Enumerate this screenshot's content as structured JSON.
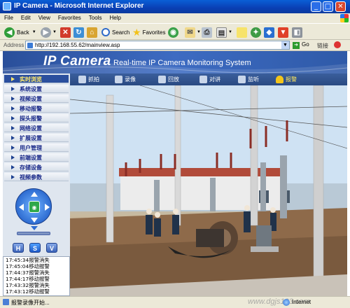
{
  "window": {
    "title": "IP Camera - Microsoft Internet Explorer",
    "min_label": "_",
    "max_label": "□",
    "close_label": "✕"
  },
  "menu": [
    "File",
    "Edit",
    "View",
    "Favorites",
    "Tools",
    "Help"
  ],
  "toolbar": {
    "back_label": "Back",
    "search_label": "Search",
    "favorites_label": "Favorites"
  },
  "address": {
    "label": "Address",
    "url": "http://192.168.55.62/mainview.asp",
    "go_label": "Go",
    "links_label": "链接"
  },
  "page": {
    "logo": "IP Camera",
    "subtitle": "Real-time IP Camera Monitoring System",
    "sidebar_menu": [
      "实时浏览",
      "系统设置",
      "视频设置",
      "移动报警",
      "探头报警",
      "网络设置",
      "扩展设置",
      "用户管理",
      "前端设置",
      "存储设备",
      "视频参数"
    ],
    "active_menu_index": 0,
    "controls": {
      "snapshot": "抓拍",
      "record": "录像",
      "playback": "回放",
      "talk": "对讲",
      "listen": "监听",
      "alarm": "报警"
    },
    "ptz_center_label": "◉",
    "speed_buttons": [
      "H",
      "S",
      "V"
    ],
    "log_entries": [
      "17:45:34报警消失",
      "17:45:04移动报警",
      "17:44:37报警消失",
      "17:44:17移动报警",
      "17:43:32报警消失",
      "17:43:12移动报警"
    ]
  },
  "status": {
    "text": "报警录像开始...",
    "zone": "Internet",
    "watermark": "www.dgjs123.com"
  },
  "colors": {
    "header_blue": "#3d6bc2",
    "active_menu": "#2b4f9e",
    "alarm_yellow": "#ffe75c"
  }
}
